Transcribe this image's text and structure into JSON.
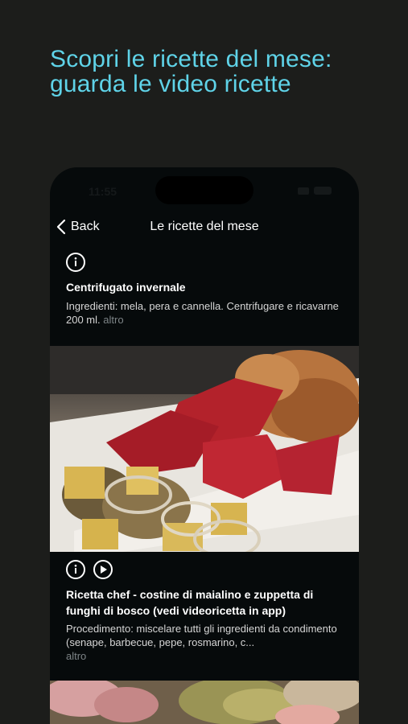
{
  "headline": "Scopri le ricette del mese: guarda le video ricette",
  "status_bar": {
    "time": "11:55"
  },
  "nav": {
    "back_label": "Back",
    "title": "Le ricette del mese"
  },
  "recipes": [
    {
      "title": "Centrifugato invernale",
      "description": "Ingredienti: mela, pera e cannella. Centrifugare e ricavarne 200 ml.",
      "more_label": "altro",
      "icons": [
        "info-icon"
      ]
    },
    {
      "title": "Ricetta chef - costine di maialino e zuppetta di funghi di bosco (vedi videoricetta in app)",
      "description": "Procedimento: miscelare tutti gli ingredienti da condimento (senape, barbecue, pepe, rosmarino, c...",
      "more_label": "altro",
      "icons": [
        "info-icon",
        "play-icon"
      ]
    }
  ],
  "colors": {
    "accent": "#5fd3e8",
    "background": "#1c1d1b",
    "phone": "#060a0b"
  }
}
